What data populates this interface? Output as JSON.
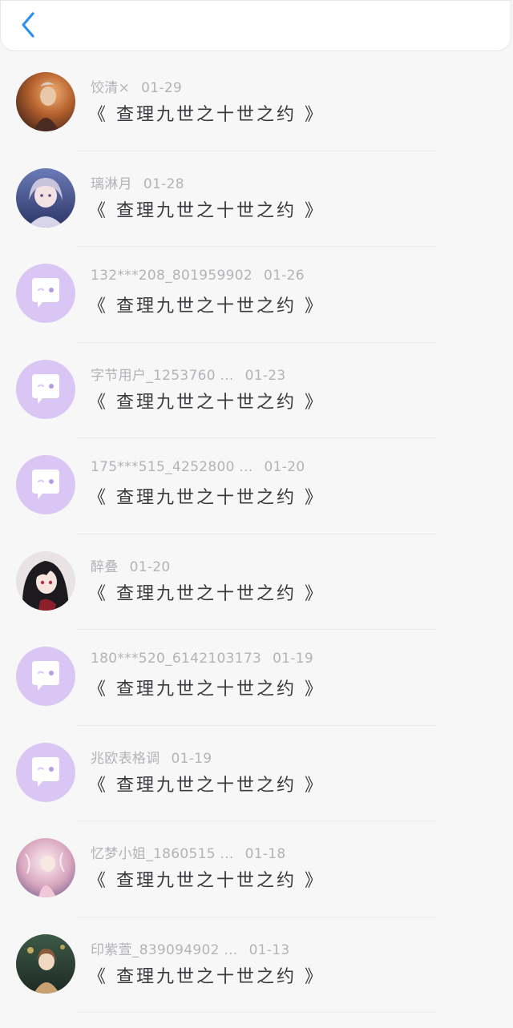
{
  "header": {
    "back_icon": "chevron-left-icon",
    "accent_color": "#2f8ff0"
  },
  "rows": [
    {
      "user": "饺清×",
      "date": "01-29",
      "title": "《 查理九世之十世之约 》",
      "avatar": "photo"
    },
    {
      "user": "璃淋月",
      "date": "01-28",
      "title": "《 查理九世之十世之约 》",
      "avatar": "photo"
    },
    {
      "user": "132***208_801959902",
      "date": "01-26",
      "title": "《 查理九世之十世之约 》",
      "avatar": "default"
    },
    {
      "user": "字节用户_1253760 ...",
      "date": "01-23",
      "title": "《 查理九世之十世之约 》",
      "avatar": "default"
    },
    {
      "user": "175***515_4252800 ...",
      "date": "01-20",
      "title": "《 查理九世之十世之约 》",
      "avatar": "default"
    },
    {
      "user": "醉叠",
      "date": "01-20",
      "title": "《 查理九世之十世之约 》",
      "avatar": "photo"
    },
    {
      "user": "180***520_6142103173",
      "date": "01-19",
      "title": "《 查理九世之十世之约 》",
      "avatar": "default"
    },
    {
      "user": "兆欧表格调",
      "date": "01-19",
      "title": "《 查理九世之十世之约 》",
      "avatar": "default"
    },
    {
      "user": "忆梦小姐_1860515 ...",
      "date": "01-18",
      "title": "《 查理九世之十世之约 》",
      "avatar": "photo"
    },
    {
      "user": "印紫萱_839094902 ...",
      "date": "01-13",
      "title": "《 查理九世之十世之约 》",
      "avatar": "photo"
    }
  ]
}
